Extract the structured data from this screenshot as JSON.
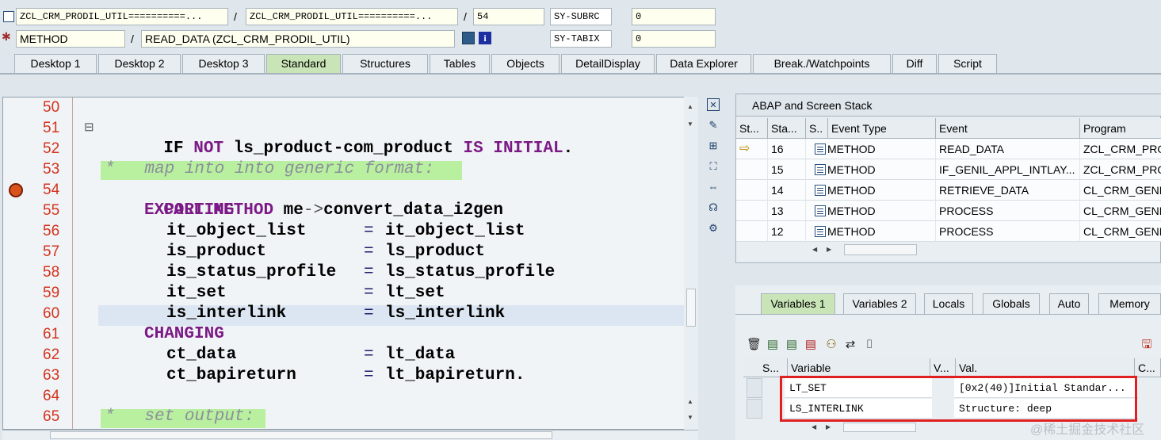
{
  "header": {
    "row1": {
      "program_field": "ZCL_CRM_PRODIL_UTIL==========...",
      "include_field": "ZCL_CRM_PRODIL_UTIL==========...",
      "line_field": "54",
      "sysvar_label": "SY-SUBRC",
      "sysvar_value": "0"
    },
    "row2": {
      "type_field": "METHOD",
      "method_field": "READ_DATA (ZCL_CRM_PRODIL_UTIL)",
      "sysvar_label": "SY-TABIX",
      "sysvar_value": "0"
    },
    "separator": "/"
  },
  "tabs": [
    "Desktop 1",
    "Desktop 2",
    "Desktop 3",
    "Standard",
    "Structures",
    "Tables",
    "Objects",
    "DetailDisplay",
    "Data Explorer",
    "Break./Watchpoints",
    "Diff",
    "Script"
  ],
  "active_tab": "Standard",
  "editor": {
    "lines": [
      {
        "num": "50"
      },
      {
        "num": "51",
        "fold": "⊟"
      },
      {
        "num": "52"
      },
      {
        "num": "53"
      },
      {
        "num": "54"
      },
      {
        "num": "55"
      },
      {
        "num": "56"
      },
      {
        "num": "57"
      },
      {
        "num": "58"
      },
      {
        "num": "59"
      },
      {
        "num": "60"
      },
      {
        "num": "61"
      },
      {
        "num": "62"
      },
      {
        "num": "63"
      },
      {
        "num": "64"
      },
      {
        "num": "65"
      }
    ],
    "code": {
      "l51": {
        "kw1": "IF",
        "kw2": "NOT",
        "var": "ls_product-com_product",
        "kw3": "IS INITIAL",
        "end": "."
      },
      "l53": "*   map into into generic format:",
      "l54": {
        "kw1": "CALL METHOD",
        "obj": "me",
        "arrow": "->",
        "meth": "convert_data_i2gen"
      },
      "l55": "EXPORTING",
      "l56": {
        "param": "it_object_list",
        "eq": "=",
        "val": "it_object_list"
      },
      "l57": {
        "param": "is_product",
        "eq": "=",
        "val": "ls_product"
      },
      "l58": {
        "param": "is_status_profile",
        "eq": "=",
        "val": "ls_status_profile"
      },
      "l59": {
        "param": "it_set",
        "eq": "=",
        "val": "lt_set"
      },
      "l60": {
        "param": "is_interlink",
        "eq": "=",
        "val": "ls_interlink"
      },
      "l61": "CHANGING",
      "l62": {
        "param": "ct_data",
        "eq": "=",
        "val": "lt_data"
      },
      "l63": {
        "param": "ct_bapireturn",
        "eq": "=",
        "val": "lt_bapireturn."
      },
      "l65": "*   set output:"
    }
  },
  "stack": {
    "title": "ABAP and Screen Stack",
    "columns": [
      "St...",
      "Sta...",
      "S..",
      "Event Type",
      "Event",
      "Program"
    ],
    "rows": [
      {
        "level": "16",
        "type": "METHOD",
        "event": "READ_DATA",
        "program": "ZCL_CRM_PRO",
        "current": true
      },
      {
        "level": "15",
        "type": "METHOD",
        "event": "IF_GENIL_APPL_INTLAY...",
        "program": "ZCL_CRM_PRO"
      },
      {
        "level": "14",
        "type": "METHOD",
        "event": "RETRIEVE_DATA",
        "program": "CL_CRM_GENE"
      },
      {
        "level": "13",
        "type": "METHOD",
        "event": "PROCESS",
        "program": "CL_CRM_GENE"
      },
      {
        "level": "12",
        "type": "METHOD",
        "event": "PROCESS",
        "program": "CL_CRM_GENE"
      }
    ]
  },
  "variables": {
    "tabs": [
      "Variables 1",
      "Variables 2",
      "Locals",
      "Globals",
      "Auto",
      "Memory"
    ],
    "active_tab": "Variables 1",
    "columns": [
      "S...",
      "Variable",
      "V...",
      "Val.",
      "C..."
    ],
    "rows": [
      {
        "name": "LT_SET",
        "value": "[0x2(40)]Initial Standar..."
      },
      {
        "name": "LS_INTERLINK",
        "value": "Structure: deep"
      }
    ]
  },
  "watermark": "@稀土掘金技术社区",
  "colors": {
    "active_tab": "#c9e5b7",
    "comment_bg": "#b9f0a0",
    "line_number": "#d4331f",
    "keyword": "#7b1a86",
    "highlight": "#e02020"
  }
}
